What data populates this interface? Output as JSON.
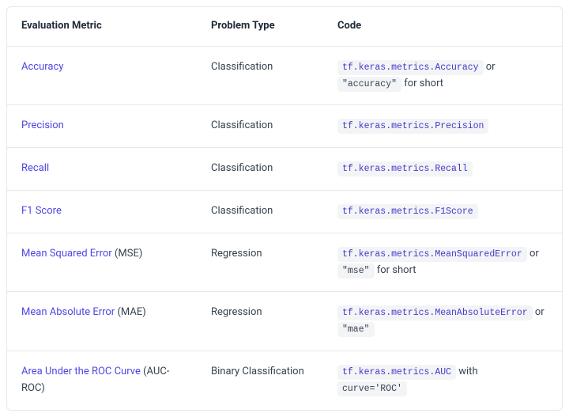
{
  "headers": {
    "metric": "Evaluation Metric",
    "type": "Problem Type",
    "code": "Code"
  },
  "rows": [
    {
      "metric_link": "Accuracy",
      "metric_suffix": "",
      "type": "Classification",
      "code1": "tf.keras.metrics.Accuracy",
      "code1_plain": false,
      "joiner": " or ",
      "code2": "\"accuracy\"",
      "code2_plain": true,
      "suffix": " for short"
    },
    {
      "metric_link": "Precision",
      "metric_suffix": "",
      "type": "Classification",
      "code1": "tf.keras.metrics.Precision",
      "code1_plain": false,
      "joiner": "",
      "code2": "",
      "code2_plain": true,
      "suffix": ""
    },
    {
      "metric_link": "Recall",
      "metric_suffix": "",
      "type": "Classification",
      "code1": "tf.keras.metrics.Recall",
      "code1_plain": false,
      "joiner": "",
      "code2": "",
      "code2_plain": true,
      "suffix": ""
    },
    {
      "metric_link": "F1 Score",
      "metric_suffix": "",
      "type": "Classification",
      "code1": "tf.keras.metrics.F1Score",
      "code1_plain": false,
      "joiner": "",
      "code2": "",
      "code2_plain": true,
      "suffix": ""
    },
    {
      "metric_link": "Mean Squared Error",
      "metric_suffix": " (MSE)",
      "type": "Regression",
      "code1": "tf.keras.metrics.MeanSquaredError",
      "code1_plain": false,
      "joiner": " or ",
      "code2": "\"mse\"",
      "code2_plain": true,
      "suffix": " for short"
    },
    {
      "metric_link": "Mean Absolute Error",
      "metric_suffix": " (MAE)",
      "type": "Regression",
      "code1": "tf.keras.metrics.MeanAbsoluteError",
      "code1_plain": false,
      "joiner": " or ",
      "code2": "\"mae\"",
      "code2_plain": true,
      "suffix": ""
    },
    {
      "metric_link": "Area Under the ROC Curve",
      "metric_suffix": " (AUC-ROC)",
      "type": "Binary Classification",
      "code1": "tf.keras.metrics.AUC",
      "code1_plain": false,
      "joiner": " with ",
      "code2": "curve='ROC'",
      "code2_plain": true,
      "suffix": ""
    }
  ]
}
